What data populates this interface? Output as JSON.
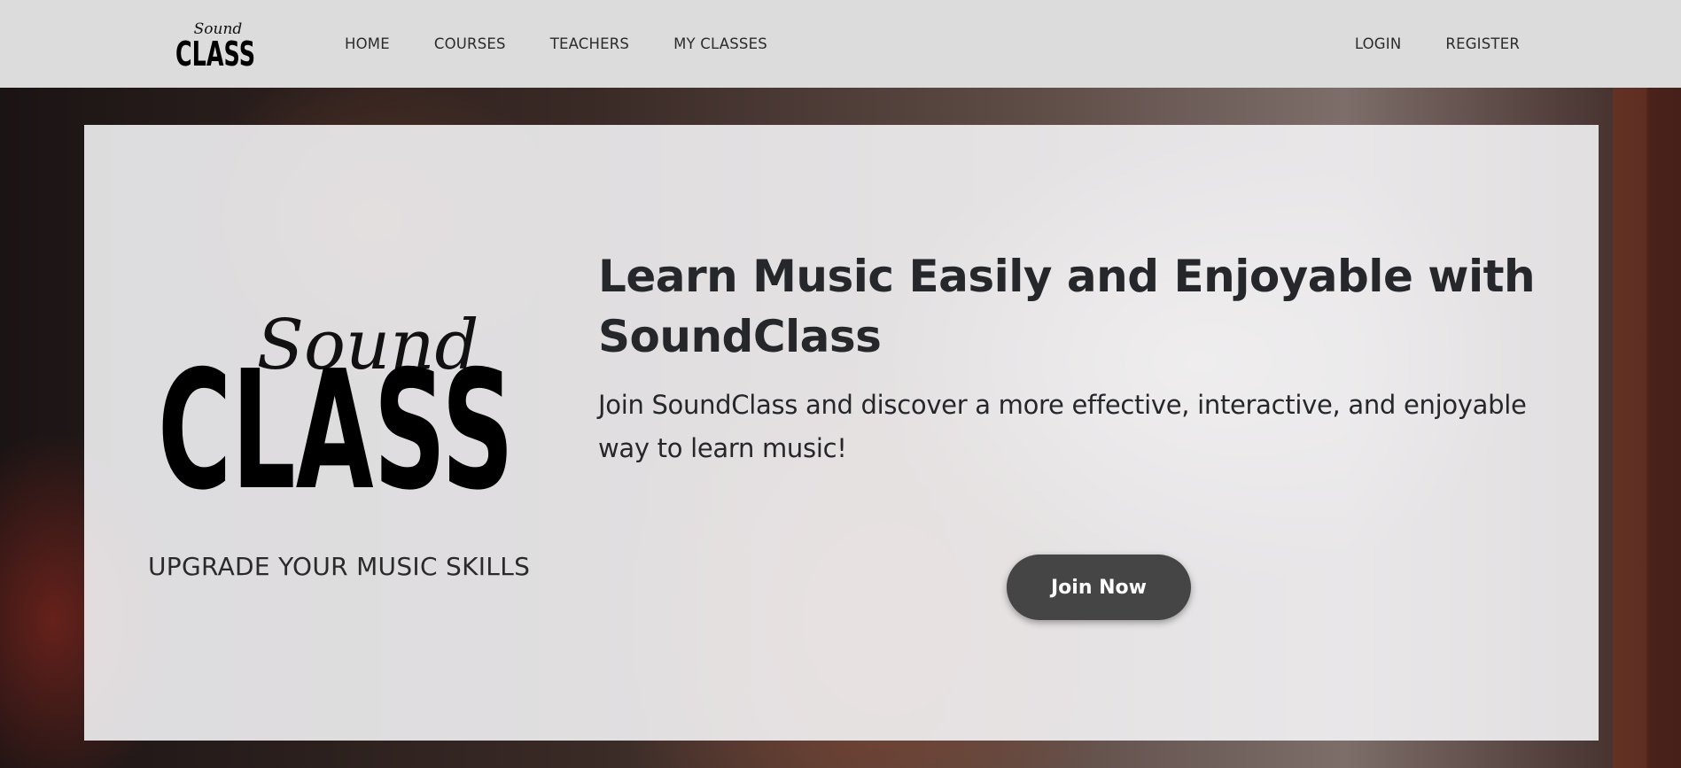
{
  "nav": {
    "logo_script": "Sound",
    "logo_word": "CLASS",
    "links": [
      "HOME",
      "COURSES",
      "TEACHERS",
      "MY CLASSES"
    ],
    "auth": [
      "LOGIN",
      "REGISTER"
    ]
  },
  "hero": {
    "logo_script": "Sound",
    "logo_word": "CLASS",
    "tagline": "UPGRADE YOUR MUSIC SKILLS",
    "headline": "Learn Music Easily and Enjoyable with SoundClass",
    "subtext": "Join SoundClass and discover a more effective, interactive, and enjoyable way to learn music!",
    "cta_label": "Join Now"
  },
  "colors": {
    "navbar_bg": "#dcdcdc",
    "panel_bg": "#f7f7f9",
    "text_dark": "#26272b",
    "button_bg": "#454545",
    "button_text": "#ffffff"
  }
}
